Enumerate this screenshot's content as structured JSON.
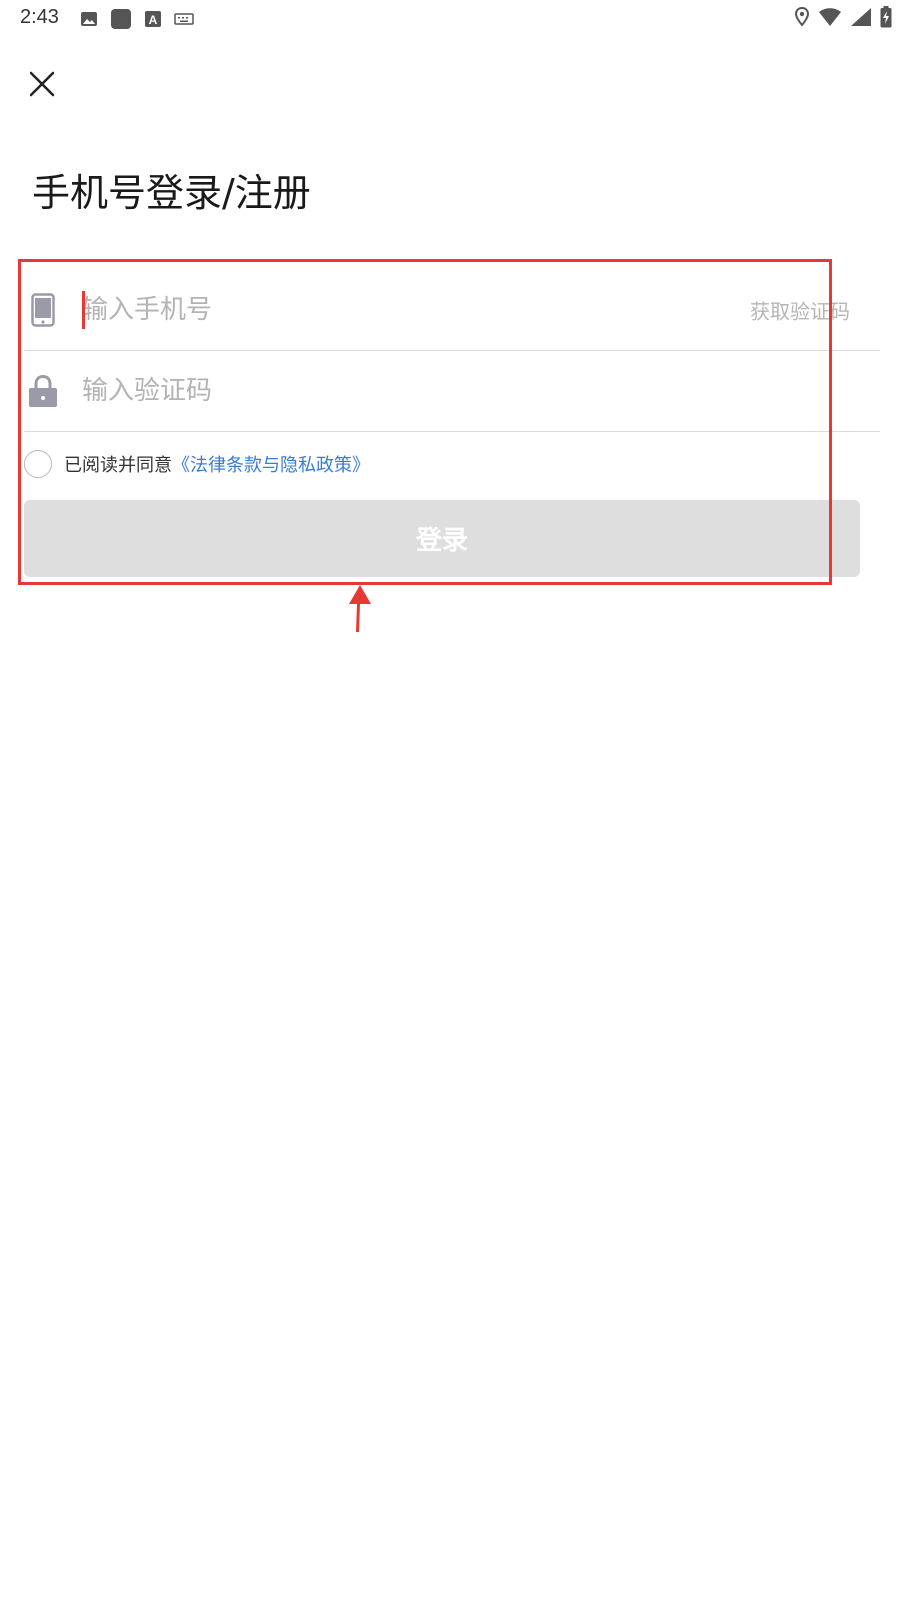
{
  "status_bar": {
    "time": "2:43",
    "left_icons": [
      "image-icon",
      "app-square-icon",
      "font-a-icon",
      "keyboard-icon"
    ],
    "right_icons": [
      "location-pin-icon",
      "wifi-icon",
      "cell-signal-icon",
      "battery-charging-icon"
    ]
  },
  "header": {
    "close_icon": "close-icon"
  },
  "page": {
    "title": "手机号登录/注册"
  },
  "form": {
    "phone": {
      "icon": "phone-icon",
      "placeholder": "输入手机号",
      "value": "",
      "get_code_label": "获取验证码"
    },
    "code": {
      "icon": "lock-icon",
      "placeholder": "输入验证码",
      "value": ""
    },
    "agreement": {
      "checked": false,
      "text": "已阅读并同意",
      "link_text": "《法律条款与隐私政策》"
    },
    "login_label": "登录"
  },
  "colors": {
    "accent_red": "#e53935",
    "link_blue": "#3a7bd5",
    "button_disabled": "#dedede",
    "placeholder_gray": "#b3b3b3"
  }
}
